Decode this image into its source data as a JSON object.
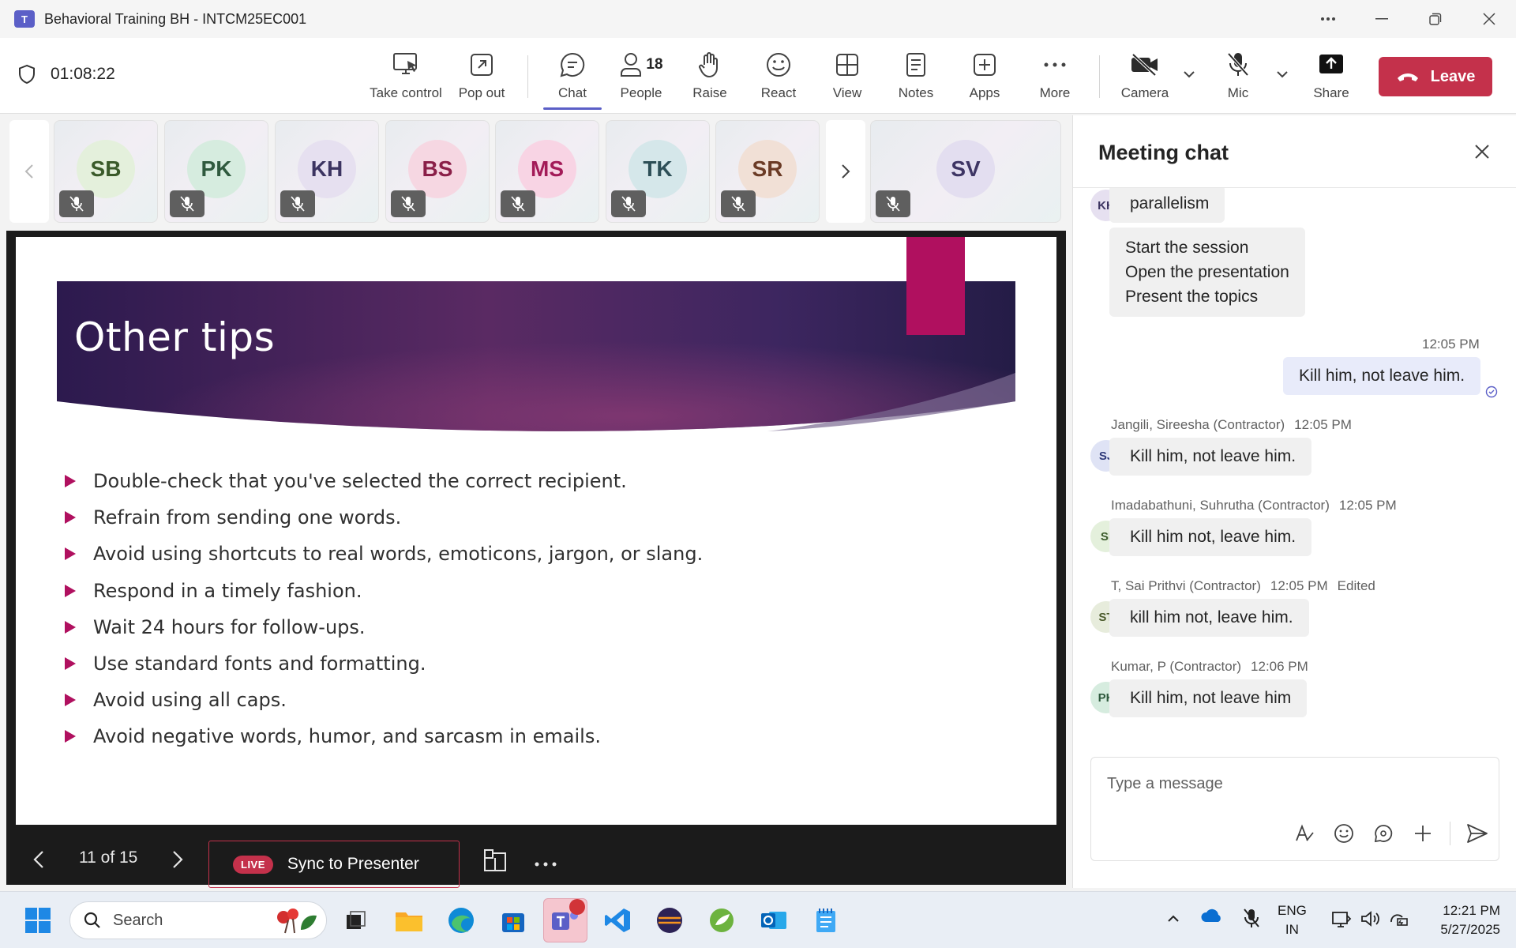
{
  "window": {
    "title": "Behavioral Training BH - INTCM25EC001",
    "app_logo_text": "T"
  },
  "meeting": {
    "elapsed": "01:08:22"
  },
  "toolbar": {
    "take_control": "Take control",
    "pop_out": "Pop out",
    "chat": "Chat",
    "people": "People",
    "people_count": "18",
    "raise": "Raise",
    "react": "React",
    "view": "View",
    "notes": "Notes",
    "apps": "Apps",
    "more": "More",
    "camera": "Camera",
    "mic": "Mic",
    "share": "Share",
    "leave": "Leave",
    "leave_color": "#c4314b",
    "accent": "#5b5fc7"
  },
  "participants": [
    {
      "initials": "SB",
      "bg": "#e4f0dc",
      "fg": "#3a5a2a"
    },
    {
      "initials": "PK",
      "bg": "#d6ecdf",
      "fg": "#2f5a3e"
    },
    {
      "initials": "KH",
      "bg": "#e6e0f0",
      "fg": "#3c3461"
    },
    {
      "initials": "BS",
      "bg": "#f6d7e2",
      "fg": "#8a1f48"
    },
    {
      "initials": "MS",
      "bg": "#f8d4e4",
      "fg": "#a31b58"
    },
    {
      "initials": "TK",
      "bg": "#d5e7ea",
      "fg": "#2d4f57"
    },
    {
      "initials": "SR",
      "bg": "#f1e0d6",
      "fg": "#6b3b26"
    },
    {
      "initials": "SV",
      "bg": "#e3def0",
      "fg": "#3e3564"
    }
  ],
  "slide": {
    "title": "Other tips",
    "bullets": [
      "Double-check that you've selected the correct recipient.",
      "Refrain from sending one words.",
      "Avoid using shortcuts to real words, emoticons, jargon, or slang.",
      "Respond in a timely fashion.",
      "Wait 24 hours for follow-ups.",
      "Use standard fonts and formatting.",
      "Avoid using all caps.",
      "Avoid negative words, humor, and sarcasm in emails."
    ],
    "page_indicator": "11 of 15",
    "live_badge": "LIVE",
    "sync_label": "Sync to Presenter"
  },
  "chat": {
    "title": "Meeting chat",
    "messages": [
      {
        "avatar": "KH",
        "text": "parallelism"
      },
      {
        "lines": [
          "Start the session",
          "Open the presentation",
          "Present the topics"
        ]
      },
      {
        "mine": true,
        "time": "12:05 PM",
        "text": "Kill him, not leave him."
      },
      {
        "sender": "Jangili, Sireesha (Contractor)",
        "time": "12:05 PM",
        "avatar": "SJ",
        "text": "Kill him, not leave him."
      },
      {
        "sender": "Imadabathuni, Suhrutha (Contractor)",
        "time": "12:05 PM",
        "avatar": "SI",
        "text": "Kill him not, leave him."
      },
      {
        "sender": "T, Sai Prithvi (Contractor)",
        "time": "12:05 PM",
        "edited": "Edited",
        "avatar": "ST",
        "text": "kill him not, leave him."
      },
      {
        "sender": "Kumar, P (Contractor)",
        "time": "12:06 PM",
        "avatar": "PK",
        "text": "Kill him, not leave him"
      }
    ],
    "placeholder": "Type a message"
  },
  "taskbar": {
    "search_label": "Search",
    "lang_top": "ENG",
    "lang_bottom": "IN",
    "time": "12:21 PM",
    "date": "5/27/2025"
  }
}
